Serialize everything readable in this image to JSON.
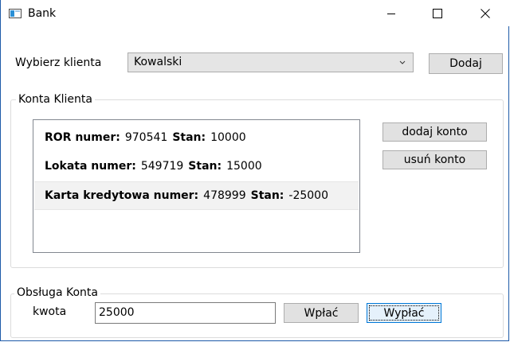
{
  "window": {
    "title": "Bank"
  },
  "client": {
    "label": "Wybierz klienta",
    "selected": "Kowalski",
    "add_button": "Dodaj"
  },
  "accounts": {
    "group_label": "Konta Klienta",
    "items": [
      {
        "type_label": "ROR numer:",
        "number": "970541",
        "balance_label": "Stan:",
        "balance": "10000"
      },
      {
        "type_label": "Lokata numer:",
        "number": "549719",
        "balance_label": "Stan:",
        "balance": "15000"
      },
      {
        "type_label": "Karta kredytowa numer:",
        "number": "478999",
        "balance_label": "Stan:",
        "balance": "-25000"
      }
    ],
    "add_account_button": "dodaj konto",
    "remove_account_button": "usuń konto"
  },
  "service": {
    "group_label": "Obsługa Konta",
    "amount_label": "kwota",
    "amount_value": "25000",
    "deposit_button": "Wpłać",
    "withdraw_button": "Wypłać"
  }
}
